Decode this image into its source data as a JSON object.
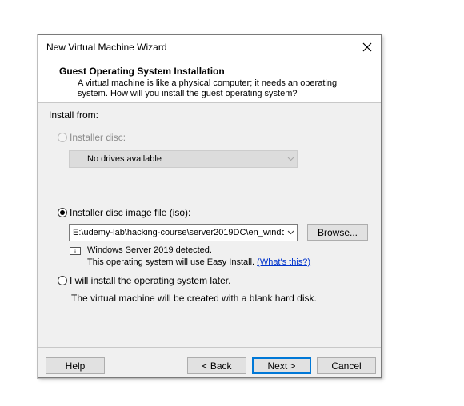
{
  "window": {
    "title": "New Virtual Machine Wizard"
  },
  "header": {
    "title": "Guest Operating System Installation",
    "description": "A virtual machine is like a physical computer; it needs an operating system. How will you install the guest operating system?"
  },
  "install_from": {
    "label": "Install from:",
    "installer_disc": {
      "label": "Installer disc:",
      "selected": false,
      "enabled": false,
      "drive_value": "No drives available"
    },
    "iso": {
      "label": "Installer disc image file (iso):",
      "selected": true,
      "path_value": "E:\\udemy-lab\\hacking-course\\server2019DC\\en_windo",
      "browse_label": "Browse...",
      "detected_text": "Windows Server 2019 detected.",
      "easy_install_text": "This operating system will use Easy Install.",
      "whats_this_link": "(What's this?)"
    },
    "later": {
      "label": "I will install the operating system later.",
      "selected": false,
      "note": "The virtual machine will be created with a blank hard disk."
    }
  },
  "footer": {
    "help_label": "Help",
    "back_label": "< Back",
    "next_label": "Next >",
    "cancel_label": "Cancel"
  },
  "icons": {
    "close": "close-icon",
    "dropdown": "chevron-down-icon",
    "info": "info-icon"
  },
  "colors": {
    "link": "#0033cc",
    "default_button_border": "#0078d7",
    "dialog_bg": "#f0f0f0"
  }
}
